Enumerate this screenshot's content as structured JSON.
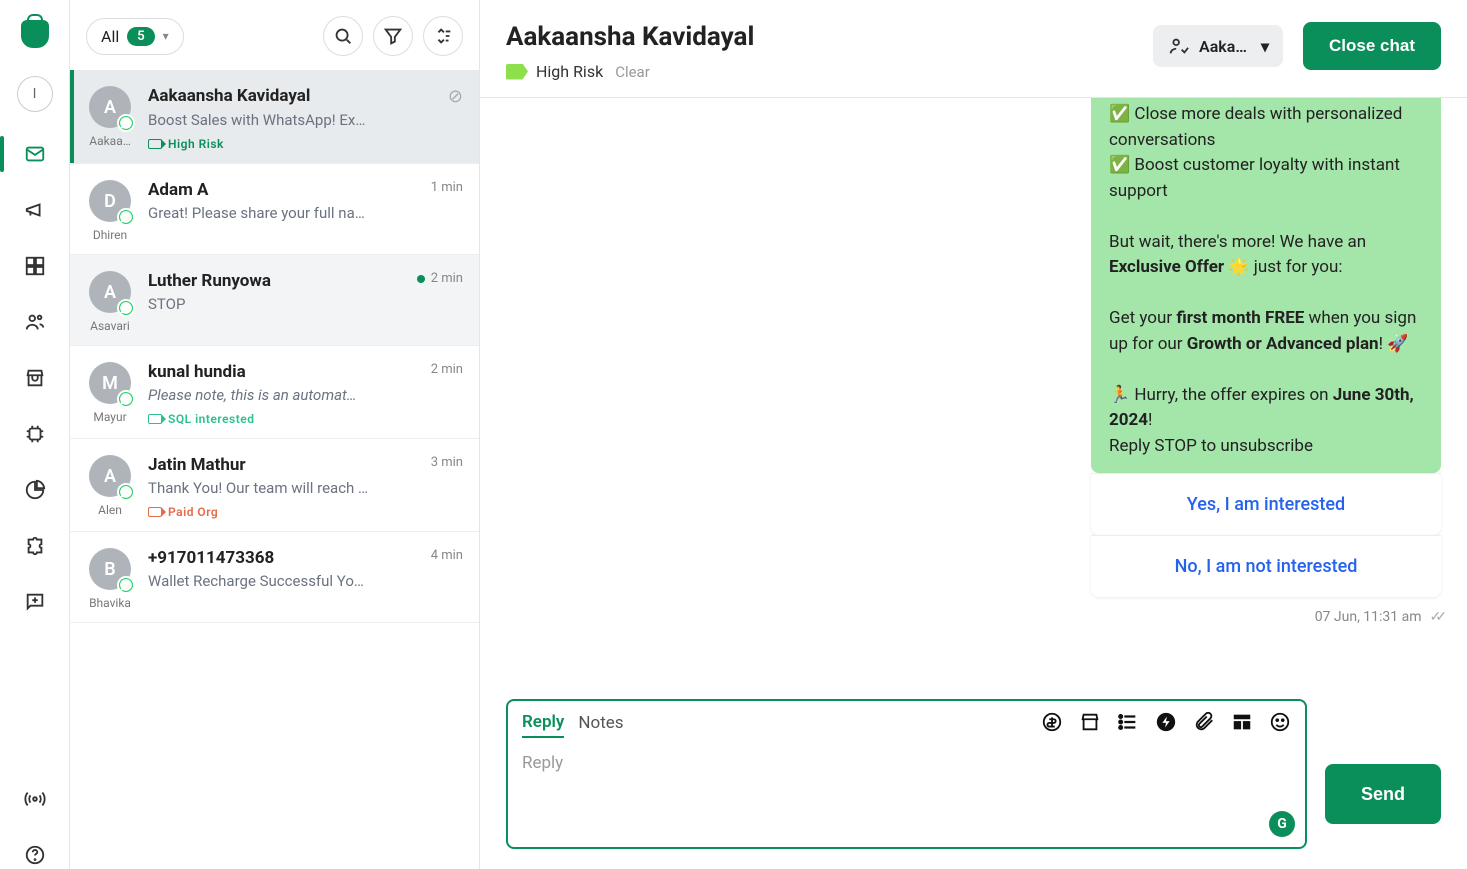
{
  "nav": {
    "avatar_initial": "I"
  },
  "filter": {
    "label": "All",
    "count": "5"
  },
  "conversations": [
    {
      "initial": "A",
      "assignee": "Aakaa…",
      "name": "Aakaansha Kavidayal",
      "preview": "Boost Sales with WhatsApp! Ex…",
      "tag": "High Risk",
      "tag_class": "tag-green",
      "time": "",
      "active": true,
      "show_close": true
    },
    {
      "initial": "D",
      "assignee": "Dhiren",
      "name": "Adam A",
      "preview": "Great! Please share your full na…",
      "time": "1 min"
    },
    {
      "initial": "A",
      "assignee": "Asavari",
      "name": "Luther Runyowa",
      "preview": "STOP",
      "time": "2 min",
      "shade": true,
      "dot": true
    },
    {
      "initial": "M",
      "assignee": "Mayur",
      "name": "kunal hundia",
      "preview": "Please note, this is an automat…",
      "preview_italic": true,
      "tag": "SQL interested",
      "tag_class": "tag-teal",
      "time": "2 min"
    },
    {
      "initial": "A",
      "assignee": "Alen",
      "name": "Jatin Mathur",
      "preview": "Thank You! Our team will reach …",
      "tag": "Paid Org",
      "tag_class": "tag-red",
      "time": "3 min"
    },
    {
      "initial": "B",
      "assignee": "Bhavika",
      "name": "+917011473368",
      "preview": "Wallet Recharge Successful Yo…",
      "time": "4 min"
    }
  ],
  "chat": {
    "title": "Aakaansha Kavidayal",
    "tag_label": "High Risk",
    "clear": "Clear",
    "assignee_short": "Aaka…",
    "close_btn": "Close chat",
    "msg": {
      "l1": " Close more deals with personalized conversations",
      "l2": " Boost customer loyalty with instant support",
      "l3a": "But wait, there's more! We have an ",
      "l3b": "Exclusive Offer",
      "l3c": " 🌟 just for you:",
      "l4a": "Get your ",
      "l4b": "first month FREE",
      "l4c": " when you sign up for our ",
      "l4d": "Growth or Advanced plan",
      "l4e": "! 🚀",
      "l5a": "🏃 Hurry, the offer expires on ",
      "l5b": "June 30th, 2024",
      "l5c": "!",
      "l6": "Reply STOP to unsubscribe"
    },
    "quick1": "Yes, I am interested",
    "quick2": "No, I am not interested",
    "timestamp": "07 Jun, 11:31 am"
  },
  "composer": {
    "tab_reply": "Reply",
    "tab_notes": "Notes",
    "placeholder": "Reply",
    "send": "Send",
    "gram": "G"
  }
}
